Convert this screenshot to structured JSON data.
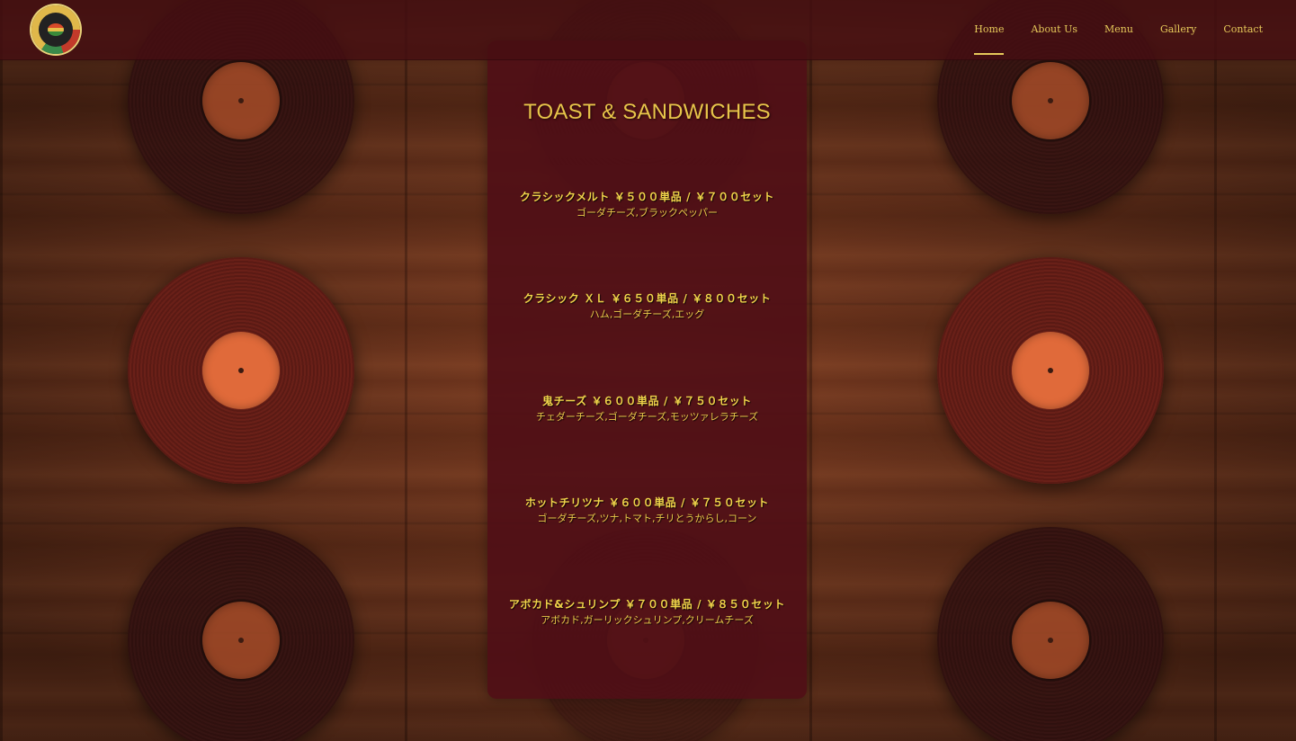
{
  "nav": {
    "items": [
      {
        "label": "Home",
        "active": true
      },
      {
        "label": "About Us"
      },
      {
        "label": "Menu"
      },
      {
        "label": "Gallery"
      },
      {
        "label": "Contact"
      }
    ]
  },
  "logo": {
    "icon": "record-logo-icon"
  },
  "menu": {
    "title": "TOAST & SANDWICHES",
    "items": [
      {
        "name": "クラシックメルト ￥５００単品 / ￥７００セット",
        "desc": "ゴーダチーズ,ブラックペッパー"
      },
      {
        "name": "クラシック ＸＬ ￥６５０単品 / ￥８００セット",
        "desc": "ハム,ゴーダチーズ,エッグ"
      },
      {
        "name": "鬼チーズ ￥６００単品 / ￥７５０セット",
        "desc": "チェダーチーズ,ゴーダチーズ,モッツァレラチーズ"
      },
      {
        "name": "ホットチリツナ ￥６００単品 / ￥７５０セット",
        "desc": "ゴーダチーズ,ツナ,トマト,チリとうからし,コーン"
      },
      {
        "name": "アボカド&シュリンプ ￥７００単品 / ￥８５０セット",
        "desc": "アボカド,ガーリックシュリンプ,クリームチーズ"
      }
    ]
  },
  "colors": {
    "accent": "#e6c95a",
    "header_bg": "#460e12",
    "panel_bg": "#500e16"
  }
}
